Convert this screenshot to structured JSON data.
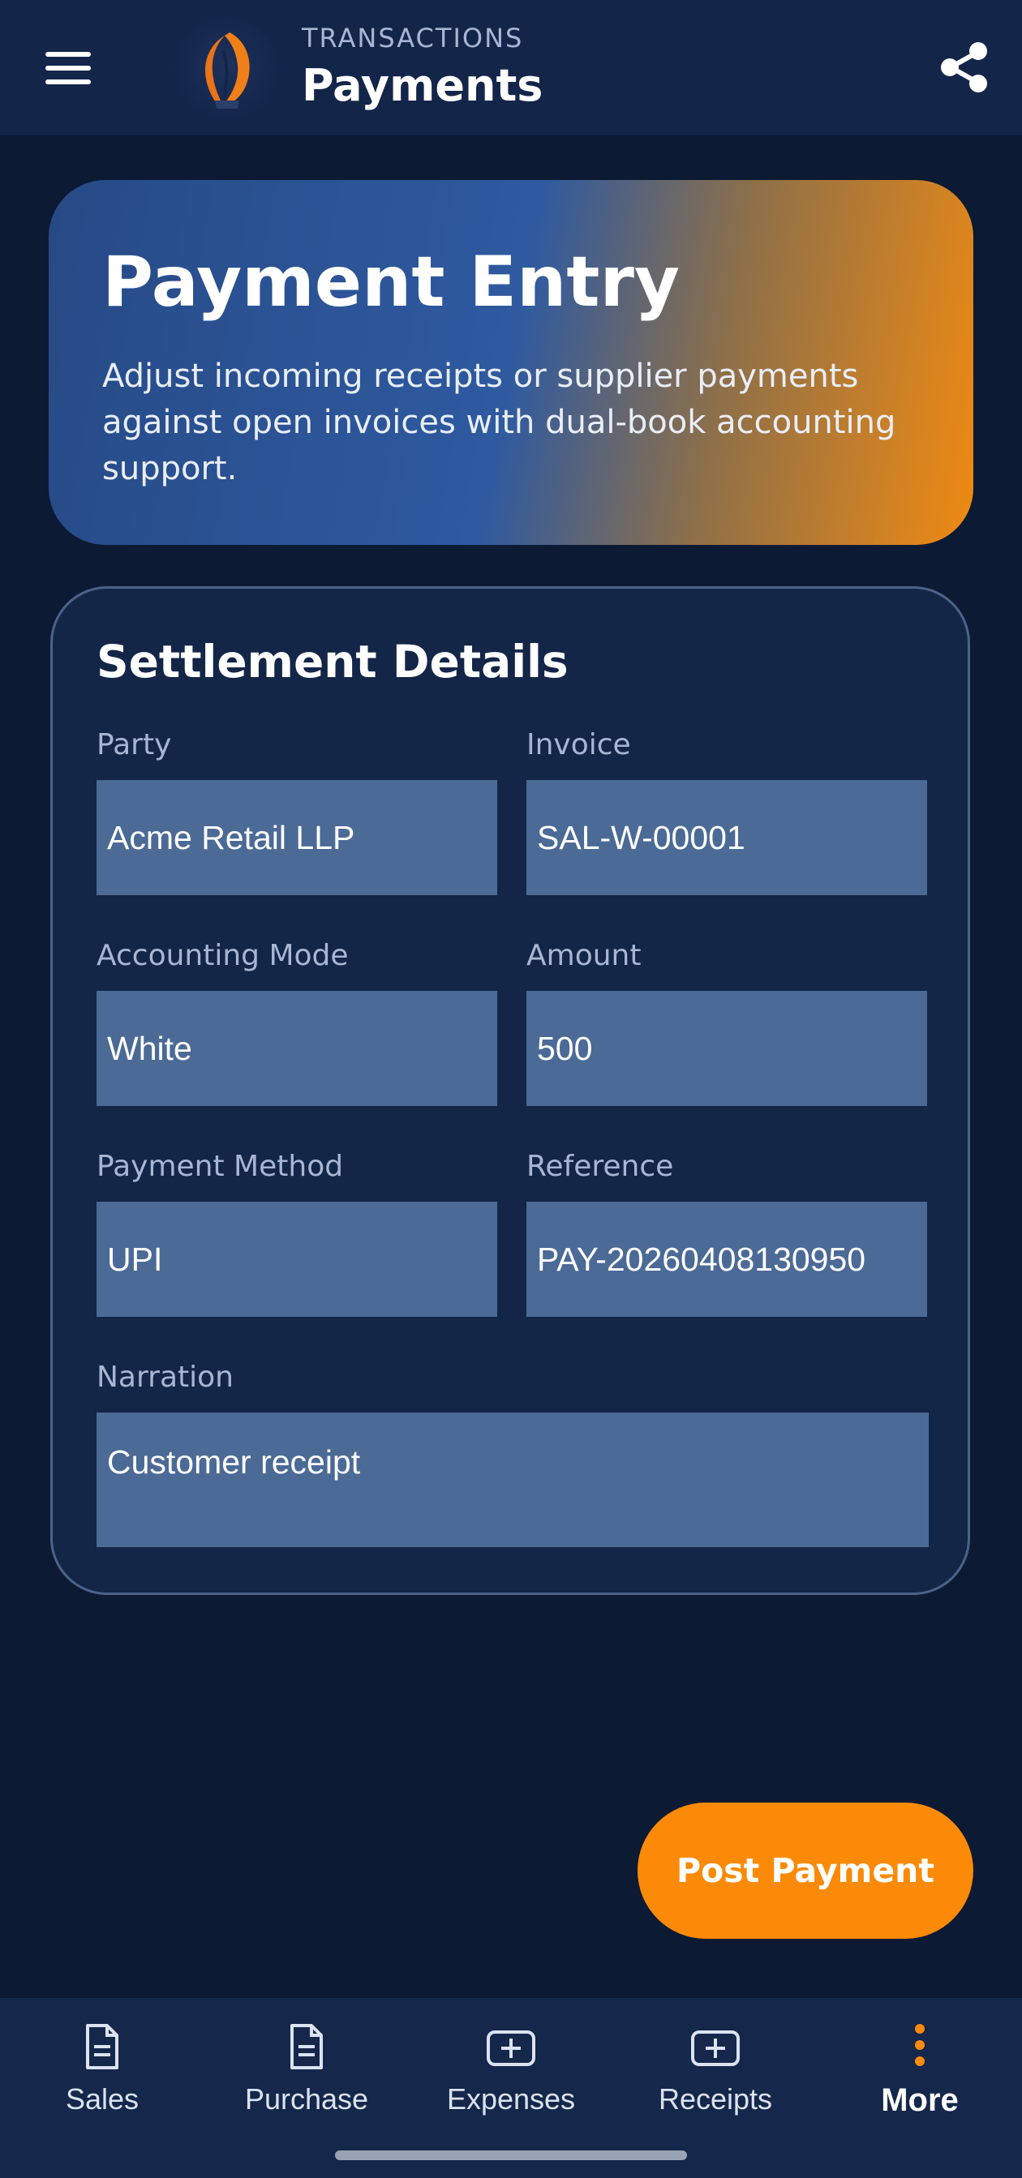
{
  "appbar": {
    "overline": "TRANSACTIONS",
    "title": "Payments"
  },
  "hero": {
    "title": "Payment Entry",
    "description": "Adjust incoming receipts or supplier payments against open invoices with dual-book accounting support."
  },
  "form": {
    "section_title": "Settlement Details",
    "fields": [
      {
        "label": "Party",
        "value": "Acme Retail LLP"
      },
      {
        "label": "Invoice",
        "value": "SAL-W-00001"
      },
      {
        "label": "Accounting Mode",
        "value": "White"
      },
      {
        "label": "Amount",
        "value": "500"
      },
      {
        "label": "Payment Method",
        "value": "UPI"
      },
      {
        "label": "Reference",
        "value": "PAY-20260408130950"
      },
      {
        "label": "Narration",
        "value": "Customer receipt"
      }
    ]
  },
  "actions": {
    "post_label": "Post Payment"
  },
  "bottom_nav": {
    "items": [
      {
        "label": "Sales",
        "icon": "document-icon",
        "active": false
      },
      {
        "label": "Purchase",
        "icon": "document-icon",
        "active": false
      },
      {
        "label": "Expenses",
        "icon": "add-box-icon",
        "active": false
      },
      {
        "label": "Receipts",
        "icon": "add-box-icon",
        "active": false
      },
      {
        "label": "More",
        "icon": "more-vertical-icon",
        "active": true
      }
    ]
  },
  "colors": {
    "background": "#0c1a33",
    "appbar": "#14254a",
    "accent": "#fb8a08",
    "input_fill": "#4b6a96",
    "card": "#132648"
  }
}
